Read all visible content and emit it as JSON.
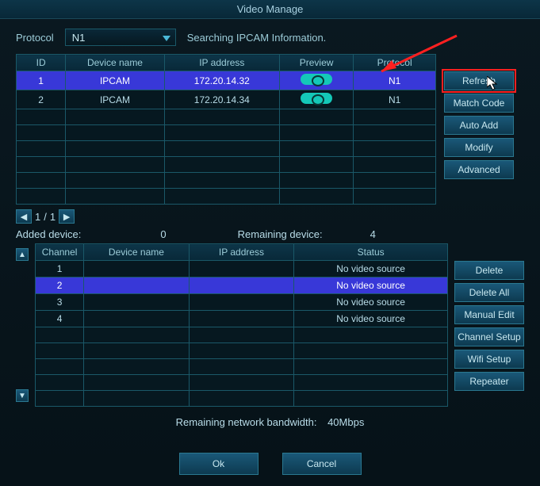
{
  "title": "Video Manage",
  "protocol": {
    "label": "Protocol",
    "value": "N1",
    "status": "Searching IPCAM Information."
  },
  "table1": {
    "headers": [
      "ID",
      "Device name",
      "IP address",
      "Preview",
      "Protocol"
    ],
    "rows": [
      {
        "id": "1",
        "name": "IPCAM",
        "ip": "172.20.14.32",
        "proto": "N1",
        "selected": true
      },
      {
        "id": "2",
        "name": "IPCAM",
        "ip": "172.20.14.34",
        "proto": "N1",
        "selected": false
      }
    ],
    "blank_rows": 6
  },
  "side_buttons": [
    "Refresh",
    "Match Code",
    "Auto Add",
    "Modify",
    "Advanced"
  ],
  "pager": {
    "current": "1",
    "total": "1"
  },
  "info": {
    "added_label": "Added device:",
    "added_count": "0",
    "remain_label": "Remaining device:",
    "remain_count": "4"
  },
  "table2": {
    "headers": [
      "Channel",
      "Device name",
      "IP address",
      "Status"
    ],
    "rows": [
      {
        "ch": "1",
        "name": "",
        "ip": "",
        "status": "No video source",
        "selected": false
      },
      {
        "ch": "2",
        "name": "",
        "ip": "",
        "status": "No video source",
        "selected": true
      },
      {
        "ch": "3",
        "name": "",
        "ip": "",
        "status": "No video source",
        "selected": false
      },
      {
        "ch": "4",
        "name": "",
        "ip": "",
        "status": "No video source",
        "selected": false
      }
    ],
    "blank_rows": 5
  },
  "side_buttons2": [
    "Delete",
    "Delete All",
    "Manual Edit",
    "Channel Setup",
    "Wifi Setup",
    "Repeater"
  ],
  "bandwidth": {
    "label": "Remaining network bandwidth:",
    "value": "40Mbps"
  },
  "footer": {
    "ok": "Ok",
    "cancel": "Cancel"
  }
}
